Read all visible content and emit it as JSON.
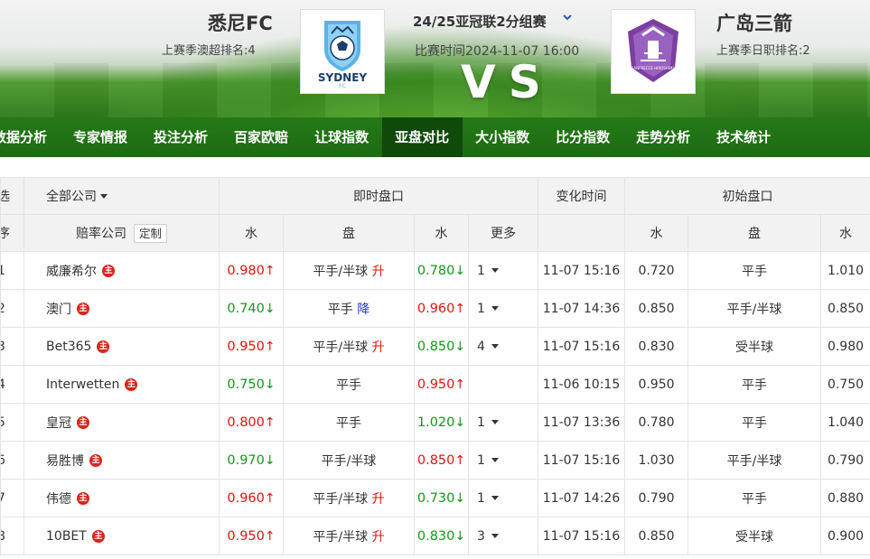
{
  "header": {
    "home": {
      "name": "悉尼FC",
      "rank": "上赛季澳超排名:4",
      "logo_text": "SYDNEY",
      "logo_sub": "FC"
    },
    "away": {
      "name": "广岛三箭",
      "rank": "上赛季日职排名:2",
      "logo_text": "SANFRECCE HIROSHIMA"
    },
    "league": "24/25亚冠联2分组赛",
    "match_time": "比赛时间2024-11-07 16:00",
    "vs": "VS"
  },
  "nav": [
    "数据分析",
    "专家情报",
    "投注分析",
    "百家欧赔",
    "让球指数",
    "亚盘对比",
    "大小指数",
    "比分指数",
    "走势分析",
    "技术统计"
  ],
  "nav_active_index": 5,
  "table": {
    "header1": {
      "idx": "选",
      "company": "全部公司",
      "live": "即时盘口",
      "change_time": "变化时间",
      "initial": "初始盘口"
    },
    "header2": {
      "idx": "序",
      "company": "赔率公司",
      "custom": "定制",
      "water": "水",
      "handicap": "盘",
      "more": "更多"
    },
    "badge": "主",
    "rows": [
      {
        "idx": "1",
        "company": "威廉希尔",
        "w1": "0.980",
        "w1_dir": "up",
        "hc": "平手/半球",
        "hc_change": "升",
        "w2": "0.780",
        "w2_dir": "down",
        "more": "1",
        "time": "11-07 15:16",
        "i_w1": "0.720",
        "i_hc": "平手",
        "i_w2": "1.010"
      },
      {
        "idx": "2",
        "company": "澳门",
        "w1": "0.740",
        "w1_dir": "down",
        "hc": "平手",
        "hc_change": "降",
        "w2": "0.960",
        "w2_dir": "up",
        "more": "1",
        "time": "11-07 14:36",
        "i_w1": "0.850",
        "i_hc": "平手/半球",
        "i_w2": "0.850"
      },
      {
        "idx": "3",
        "company": "Bet365",
        "w1": "0.950",
        "w1_dir": "up",
        "hc": "平手/半球",
        "hc_change": "升",
        "w2": "0.850",
        "w2_dir": "down",
        "more": "4",
        "time": "11-07 15:16",
        "i_w1": "0.830",
        "i_hc": "受半球",
        "i_w2": "0.980"
      },
      {
        "idx": "4",
        "company": "Interwetten",
        "w1": "0.750",
        "w1_dir": "down",
        "hc": "平手",
        "hc_change": "",
        "w2": "0.950",
        "w2_dir": "up",
        "more": "",
        "time": "11-06 10:15",
        "i_w1": "0.950",
        "i_hc": "平手",
        "i_w2": "0.750"
      },
      {
        "idx": "5",
        "company": "皇冠",
        "w1": "0.800",
        "w1_dir": "up",
        "hc": "平手",
        "hc_change": "",
        "w2": "1.020",
        "w2_dir": "down",
        "more": "1",
        "time": "11-07 13:36",
        "i_w1": "0.780",
        "i_hc": "平手",
        "i_w2": "1.040"
      },
      {
        "idx": "6",
        "company": "易胜博",
        "w1": "0.970",
        "w1_dir": "down",
        "hc": "平手/半球",
        "hc_change": "",
        "w2": "0.850",
        "w2_dir": "up",
        "more": "1",
        "time": "11-07 15:16",
        "i_w1": "1.030",
        "i_hc": "平手/半球",
        "i_w2": "0.790"
      },
      {
        "idx": "7",
        "company": "伟德",
        "w1": "0.960",
        "w1_dir": "up",
        "hc": "平手/半球",
        "hc_change": "升",
        "w2": "0.730",
        "w2_dir": "down",
        "more": "1",
        "time": "11-07 14:26",
        "i_w1": "0.790",
        "i_hc": "平手",
        "i_w2": "0.880"
      },
      {
        "idx": "8",
        "company": "10BET",
        "w1": "0.950",
        "w1_dir": "up",
        "hc": "平手/半球",
        "hc_change": "升",
        "w2": "0.830",
        "w2_dir": "down",
        "more": "3",
        "time": "11-07 15:16",
        "i_w1": "0.850",
        "i_hc": "受半球",
        "i_w2": "0.900"
      }
    ]
  },
  "colors": {
    "up": "#e0140f",
    "down": "#14961c",
    "handicap_up": "#e0140f",
    "handicap_down": "#1a37d6",
    "nav_bg": "#1f6f14",
    "nav_active": "#0f4a0a"
  },
  "arrows": {
    "up": "↑",
    "down": "↓"
  }
}
